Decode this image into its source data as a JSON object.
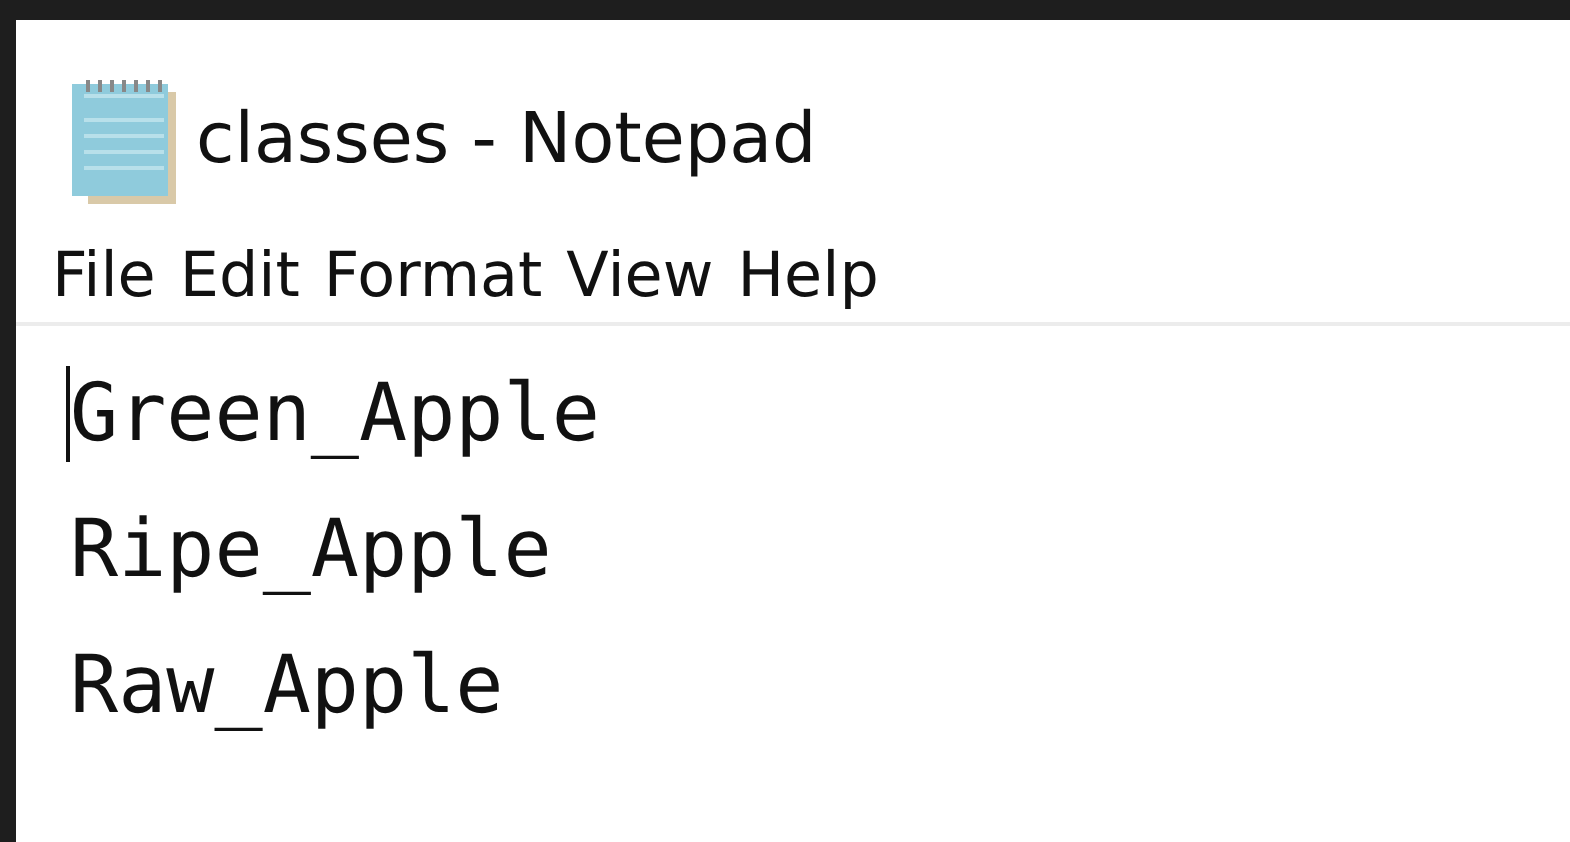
{
  "window": {
    "title": "classes - Notepad"
  },
  "menu": [
    "File",
    "Edit",
    "Format",
    "View",
    "Help"
  ],
  "editor": {
    "lines": [
      "Green_Apple",
      "Ripe_Apple",
      "Raw_Apple"
    ]
  }
}
